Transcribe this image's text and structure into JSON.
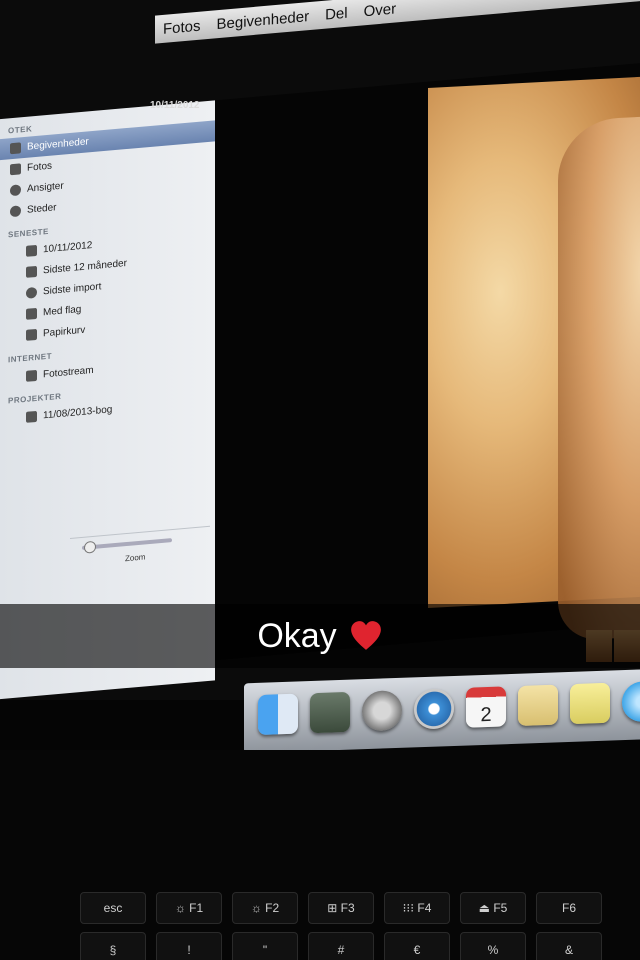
{
  "menubar": {
    "items": [
      "Fotos",
      "Begivenheder",
      "Del",
      "Over"
    ]
  },
  "sidebar": {
    "sections": [
      {
        "title": "OTEK",
        "items": [
          {
            "label": "Begivenheder",
            "selected": true,
            "icon": "events-icon"
          },
          {
            "label": "Fotos",
            "icon": "photos-icon"
          },
          {
            "label": "Ansigter",
            "icon": "faces-icon"
          },
          {
            "label": "Steder",
            "icon": "places-icon"
          }
        ]
      },
      {
        "title": "SENESTE",
        "items": [
          {
            "label": "10/11/2012",
            "icon": "event-icon"
          },
          {
            "label": "Sidste 12 måneder",
            "icon": "calendar-icon"
          },
          {
            "label": "Sidste import",
            "icon": "import-icon"
          },
          {
            "label": "Med flag",
            "icon": "flag-icon"
          },
          {
            "label": "Papirkurv",
            "icon": "trash-icon"
          }
        ]
      },
      {
        "title": "INTERNET",
        "items": [
          {
            "label": "Fotostream",
            "icon": "photostream-icon"
          }
        ]
      },
      {
        "title": "PROJEKTER",
        "items": [
          {
            "label": "11/08/2013-bog",
            "icon": "book-icon"
          }
        ]
      }
    ],
    "zoom_label": "Zoom"
  },
  "main": {
    "date": "10/11/2012"
  },
  "caption": {
    "text": "Okay",
    "emoji": "heart-icon",
    "heart_color": "#e0242f"
  },
  "dock": {
    "icons": [
      "finder-icon",
      "migration-icon",
      "launchpad-icon",
      "safari-icon",
      "calendar-icon",
      "notes-icon",
      "stickies-icon",
      "messages-icon"
    ],
    "calendar_day": "2"
  },
  "keyboard": {
    "row1": [
      "esc",
      "☼ F1",
      "☼ F2",
      "⊞ F3",
      "⁝⁝⁝ F4",
      "⏏ F5",
      "F6"
    ],
    "row2": [
      "§",
      "!",
      "\"",
      "#",
      "€",
      "%",
      "&"
    ]
  },
  "colors": {
    "accent_selection": "#6a84b0",
    "caption_bg": "rgba(0,0,0,0.62)"
  }
}
